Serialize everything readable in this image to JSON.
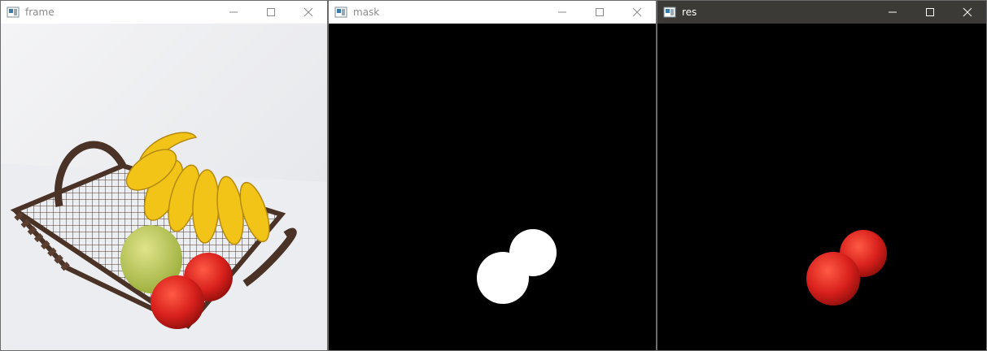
{
  "windows": [
    {
      "title": "frame",
      "active": false
    },
    {
      "title": "mask",
      "active": false
    },
    {
      "title": "res",
      "active": true
    }
  ],
  "controls": {
    "minimize": "minimize-icon",
    "maximize": "maximize-icon",
    "close": "close-icon"
  },
  "colors": {
    "titlebar_inactive": "#ffffff",
    "titlebar_active": "#3c3a37",
    "mask_background": "#000000",
    "mask_blob": "#ffffff",
    "tomato": "#d8201c",
    "banana": "#f2c417",
    "pear": "#b9c94b",
    "basket": "#4a3326"
  }
}
